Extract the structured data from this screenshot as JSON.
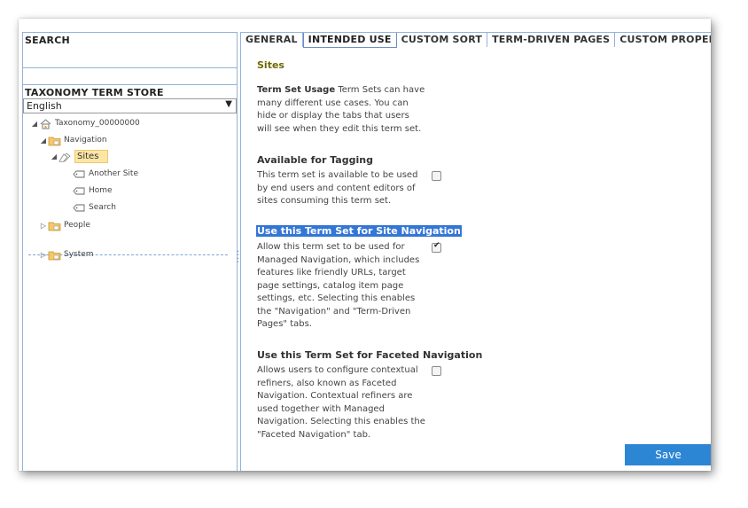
{
  "left": {
    "search_title": "SEARCH",
    "store_title": "TAXONOMY TERM STORE",
    "language": "English",
    "tree": {
      "root": "Taxonomy_00000000",
      "navigation": "Navigation",
      "sites": "Sites",
      "children": [
        "Another Site",
        "Home",
        "Search"
      ],
      "people": "People",
      "system": "System"
    }
  },
  "tabs": [
    "GENERAL",
    "INTENDED USE",
    "CUSTOM SORT",
    "TERM-DRIVEN PAGES",
    "CUSTOM PROPERTIES"
  ],
  "active_tab": "INTENDED USE",
  "content": {
    "title": "Sites",
    "usage_label": "Term Set Usage",
    "usage_text": "Term Sets can have many different use cases. You can hide or display the tabs that users will see when they edit this term set.",
    "tagging_heading": "Available for Tagging",
    "tagging_text": "This term set is available to be used by end users and content editors of sites consuming this term set.",
    "tagging_checked": false,
    "navigation_heading": "Use this Term Set for Site Navigation",
    "navigation_text": "Allow this term set to be used for Managed Navigation, which includes features like friendly URLs, target page settings, catalog item page settings, etc. Selecting this enables the \"Navigation\" and \"Term-Driven Pages\" tabs.",
    "navigation_checked": true,
    "faceted_heading": "Use this Term Set for Faceted Navigation",
    "faceted_text": "Allows users to configure contextual refiners, also known as Faceted Navigation. Contextual refiners are used together with Managed Navigation. Selecting this enables the \"Faceted Navigation\" tab.",
    "faceted_checked": false,
    "save_label": "Save"
  },
  "colors": {
    "accent": "#2d86d4",
    "highlight": "#3476d6",
    "selected_bg": "#fce6a4",
    "title_olive": "#6e6a00",
    "border": "#92b3d9"
  },
  "icons": {
    "root": "taxonomy-root-icon",
    "group": "term-group-folder-icon",
    "termset": "term-set-icon",
    "term": "term-tag-icon"
  }
}
